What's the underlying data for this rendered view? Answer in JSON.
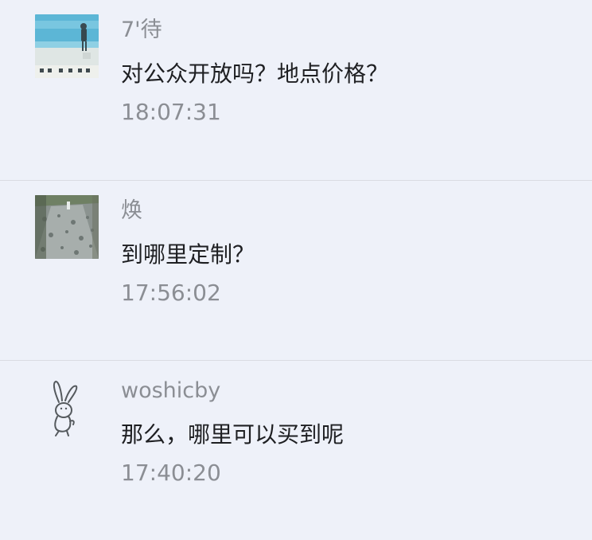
{
  "comments": [
    {
      "author": "7'待",
      "avatar_icon": "beach-photo-avatar-icon",
      "text": "对公众开放吗？地点价格？",
      "time": "18:07:31"
    },
    {
      "author": "焕",
      "avatar_icon": "garden-path-photo-avatar-icon",
      "text": "到哪里定制？",
      "time": "17:56:02"
    },
    {
      "author": "woshicby",
      "avatar_icon": "rabbit-sketch-avatar-icon",
      "text": "那么，哪里可以买到呢",
      "time": "17:40:20"
    }
  ],
  "colors": {
    "background": "#eef1f9",
    "divider": "#d9dbe2",
    "author_text": "#8b8e94",
    "body_text": "#1e1f22"
  }
}
